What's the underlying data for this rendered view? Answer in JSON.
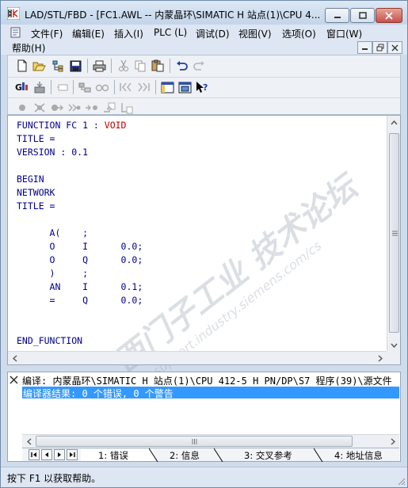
{
  "window": {
    "title": "LAD/STL/FBD  - [FC1.AWL -- 内蒙晶环\\SIMATIC H 站点(1)\\CPU 4..."
  },
  "menu": {
    "items": [
      "文件(F)",
      "编辑(E)",
      "插入(I)",
      "PLC (L)",
      "调试(D)",
      "视图(V)",
      "选项(O)",
      "窗口(W)"
    ],
    "help": "帮助(H)"
  },
  "toolbar": {
    "row1": [
      "new-icon",
      "open-icon",
      "save-icon",
      "print-icon",
      "cut-icon",
      "copy-icon",
      "paste-icon",
      "undo-icon",
      "redo-icon"
    ],
    "row2": [
      "online-icon",
      "download-icon",
      "insert-network-icon",
      "tree-icon",
      "glasses-icon",
      "first-nav-icon",
      "last-nav-icon",
      "overview-icon",
      "catalog-icon",
      "context-help-icon"
    ],
    "row3": [
      "contact-icon",
      "breakpoint-icon",
      "monitor-icon",
      "run-icon",
      "step-icon",
      "jump-icon",
      "call-icon"
    ]
  },
  "editor": {
    "lines": [
      {
        "a": "FUNCTION FC 1 : ",
        "b": "VOID"
      },
      {
        "a": "TITLE =",
        "b": ""
      },
      {
        "a": "VERSION : 0.1",
        "b": ""
      },
      {
        "a": "",
        "b": ""
      },
      {
        "a": "BEGIN",
        "b": ""
      },
      {
        "a": "NETWORK",
        "b": ""
      },
      {
        "a": "TITLE =",
        "b": ""
      },
      {
        "a": "",
        "b": ""
      },
      {
        "a": "      A(    ;",
        "b": ""
      },
      {
        "a": "      O     I      0.0;",
        "b": ""
      },
      {
        "a": "      O     Q      0.0;",
        "b": ""
      },
      {
        "a": "      )     ;",
        "b": ""
      },
      {
        "a": "      AN    I      0.1;",
        "b": ""
      },
      {
        "a": "      =     Q      0.0;",
        "b": ""
      },
      {
        "a": "",
        "b": ""
      },
      {
        "a": "",
        "b": ""
      },
      {
        "a": "END_FUNCTION",
        "b": ""
      }
    ],
    "watermark_cn": "西门子工业 技术论坛",
    "watermark_url": "support.industry.siemens.com/cs"
  },
  "output": {
    "line1": "编译: 内蒙晶环\\SIMATIC H 站点(1)\\CPU 412-5 H PN/DP\\S7 程序(39)\\源文件",
    "line2": "编译器结果: 0 个错误, 0 个警告",
    "tabs": [
      "1: 错误",
      "2: 信息",
      "3: 交叉参考",
      "4: 地址信息"
    ]
  },
  "status": {
    "text": "按下 F1 以获取帮助。"
  },
  "colors": {
    "selection": "#3399ff",
    "code_text": "#00008b",
    "keyword": "#c00000"
  }
}
